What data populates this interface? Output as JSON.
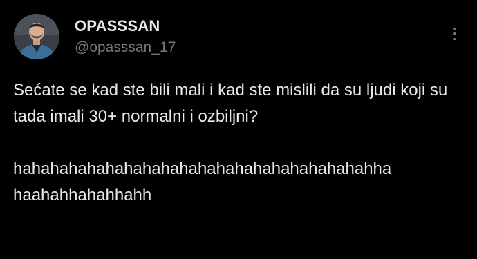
{
  "author": {
    "display_name": "OPASSSAN",
    "handle": "@opasssan_17",
    "avatar_icon": "profile-photo"
  },
  "more_icon": "more-vertical-icon",
  "tweet": {
    "paragraph_1": "Sećate se kad ste bili mali i kad ste mislili da su ljudi koji su tada imali 30+ normalni i ozbiljni?",
    "paragraph_2_line_1": "hahahahahahahahahahahahahahahahahahahahha",
    "paragraph_2_line_2": "haahahhahahhahh"
  },
  "colors": {
    "background": "#000000",
    "text_primary": "#e7e9ea",
    "text_secondary": "#71767b"
  }
}
